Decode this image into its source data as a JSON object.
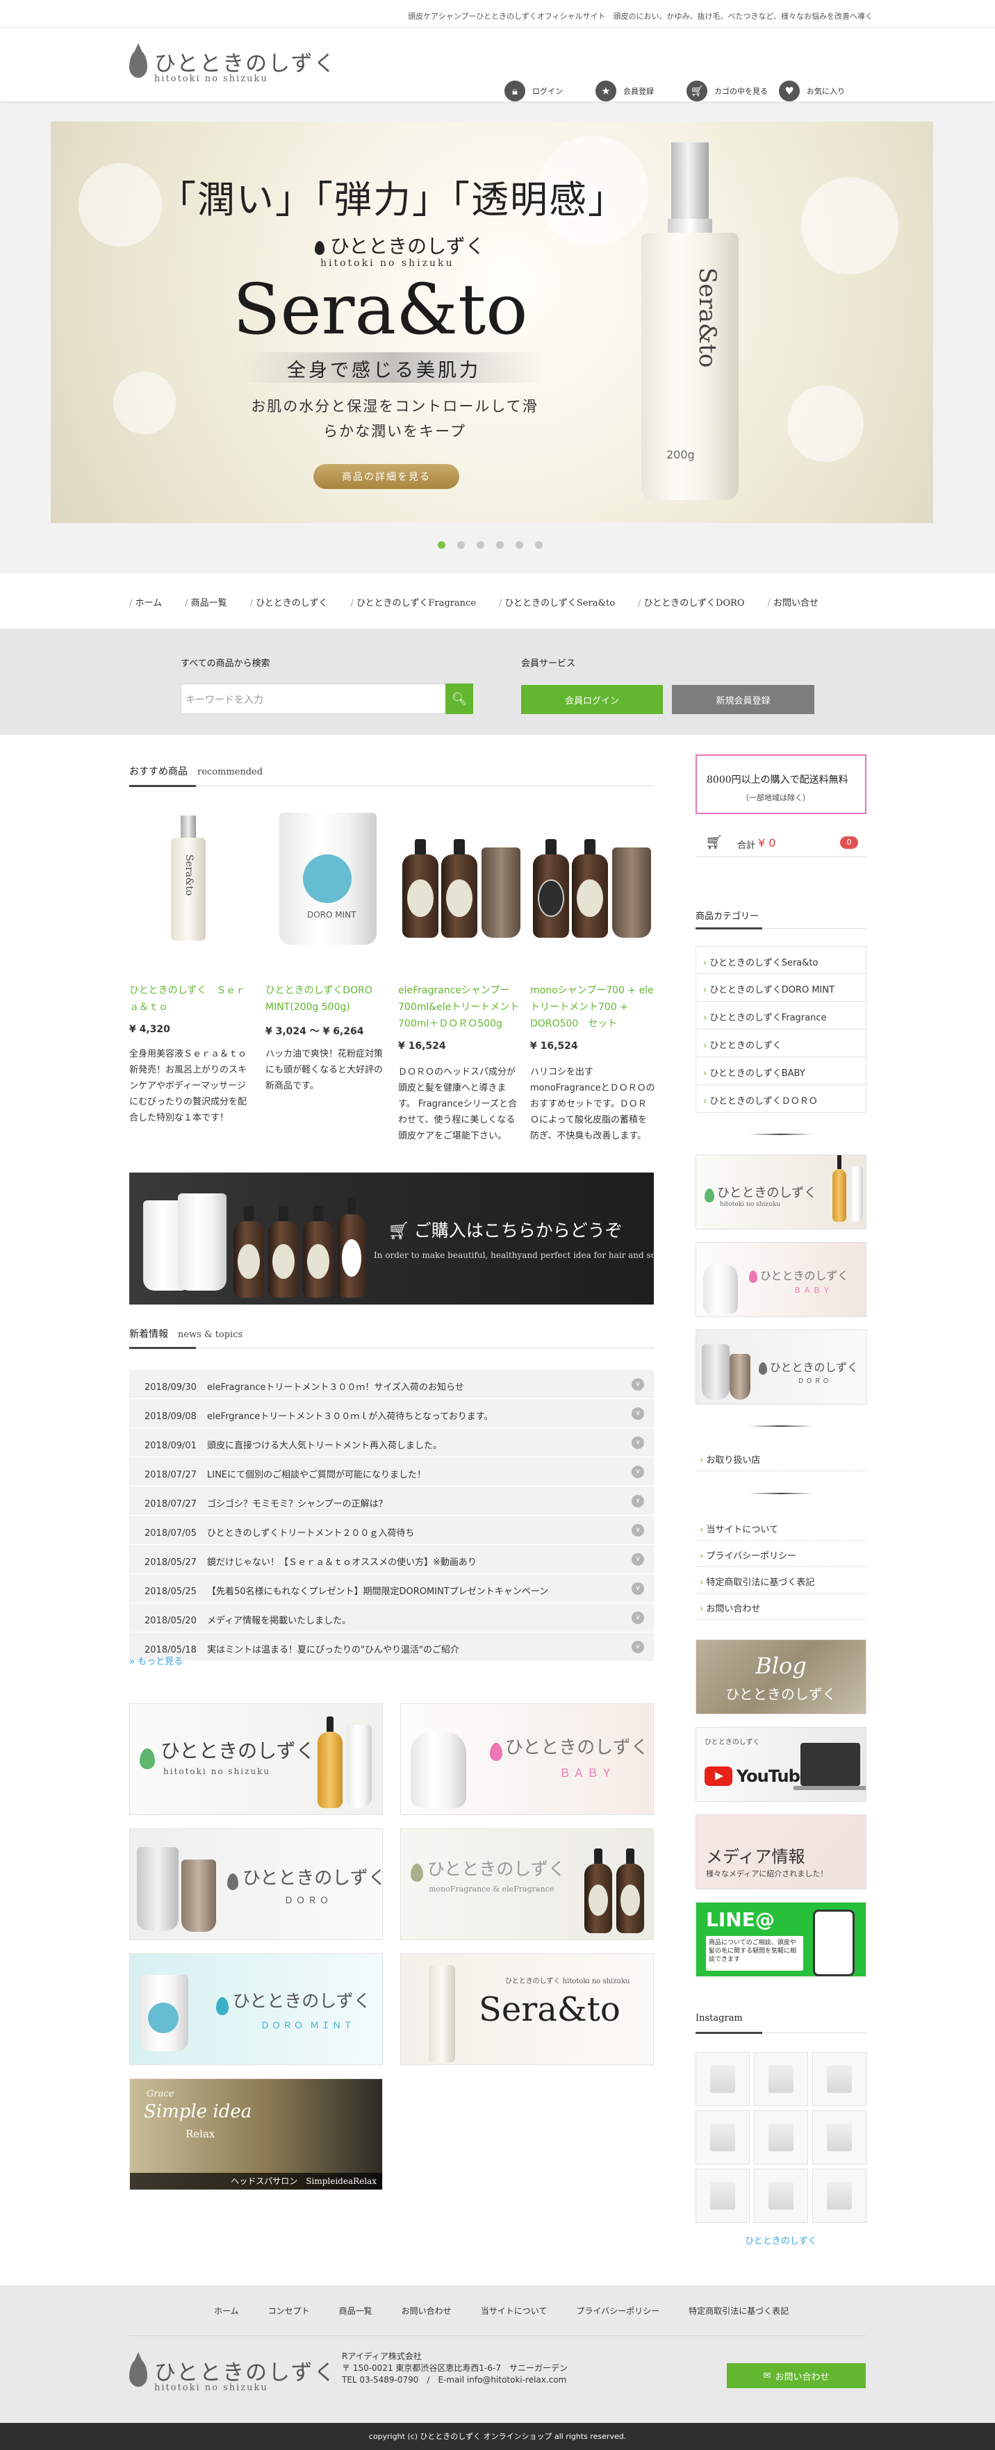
{
  "topbar": {
    "tagline": "頭皮ケアシャンプーひとときのしずくオフィシャルサイト　頭皮のにおい、かゆみ、抜け毛、べたつきなど、様々なお悩みを改善へ導く"
  },
  "logo": {
    "jp": "ひとときのしずく",
    "en": "hitotoki no shizuku"
  },
  "header_nav": [
    {
      "label": "ログイン",
      "icon": "lock-icon"
    },
    {
      "label": "会員登録",
      "icon": "star-icon"
    },
    {
      "label": "カゴの中を見る",
      "icon": "cart-icon"
    },
    {
      "label": "お気に入り",
      "icon": "heart-icon"
    }
  ],
  "hero": {
    "headline": "「潤い」「弾力」「透明感」",
    "brand_jp": "ひとときのしずく",
    "brand_en": "hitotoki no shizuku",
    "product": "Sera&to",
    "subhead": "全身で感じる美肌力",
    "copy": "お肌の水分と保湿をコントロールして滑らかな潤いをキープ",
    "button": "商品の詳細を見る",
    "bottle_text": "Sera&to",
    "bottle_size": "200g",
    "slides": 6,
    "active_slide": 1
  },
  "global_nav": [
    "ホーム",
    "商品一覧",
    "ひとときのしずく",
    "ひとときのしずくFragrance",
    "ひとときのしずくSera&to",
    "ひとときのしずくDORO",
    "お問い合せ"
  ],
  "search": {
    "title": "すべての商品から検索",
    "placeholder": "キーワードを入力",
    "member_title": "会員サービス",
    "login": "会員ログイン",
    "register": "新規会員登録"
  },
  "recommended": {
    "title": "おすすめ商品",
    "title_en": "recommended",
    "items": [
      {
        "name": "ひとときのしずく　Ｓｅｒａ＆ｔｏ",
        "price": "¥ 4,320",
        "desc": "全身用美容液Ｓｅｒａ＆ｔｏ新発売！お風呂上がりのスキンケアやボディーマッサージにむびったりの贅沢成分を配合した特別な１本です！"
      },
      {
        "name": "ひとときのしずくDORO MINT(200g 500g)",
        "price": "¥ 3,024 ～ ¥ 6,264",
        "desc": "ハッカ油で爽快！花粉症対策にも頭が軽くなると大好評の新商品です。"
      },
      {
        "name": "eleFragranceシャンプー700ml&eleトリートメント700ml＋ＤＯＲＯ500g",
        "price": "¥ 16,524",
        "desc": "ＤＯＲＯのヘッドスパ成分が頭皮と髪を健康へと導きます。 Fragranceシリーズと合わせて、使う程に美しくなる頭皮ケアをご堪能下さい。"
      },
      {
        "name": "monoシャンプー700 + eleトリートメント700 + DORO500　セット",
        "price": "¥ 16,524",
        "desc": "ハリコシを出すmonoFragranceとＤＯＲＯのおすすめセットです。ＤＯＲＯによって酸化皮脂の蓄積を防ぎ、不快臭も改善します。"
      }
    ]
  },
  "purchase_banner": {
    "title": "ご購入はこちらからどうぞ",
    "subtitle": "In order to make beautiful, healthyand perfect idea for hair and scalp."
  },
  "news": {
    "title": "新着情報",
    "title_en": "news & topics",
    "items": [
      {
        "date": "2018/09/30",
        "text": "eleFragranceトリートメント３００ｍ！サイズ入荷のお知らせ"
      },
      {
        "date": "2018/09/08",
        "text": "eleFrgranceトリートメント３００ｍｌが入荷待ちとなっております。"
      },
      {
        "date": "2018/09/01",
        "text": "頭皮に直接つける大人気トリートメント再入荷しました。"
      },
      {
        "date": "2018/07/27",
        "text": "LINEにて個別のご相談やご質問が可能になりました！"
      },
      {
        "date": "2018/07/27",
        "text": "ゴシゴシ？モミモミ？シャンプーの正解は？"
      },
      {
        "date": "2018/07/05",
        "text": "ひとときのしずくトリートメント２００ｇ入荷待ち"
      },
      {
        "date": "2018/05/27",
        "text": "鏡だけじゃない！【Ｓｅｒａ＆ｔｏオススメの使い方】※動画あり"
      },
      {
        "date": "2018/05/25",
        "text": "【先着50名様にもれなくプレゼント】期間限定DOROMINTプレゼントキャンペーン"
      },
      {
        "date": "2018/05/20",
        "text": "メディア情報を掲載いたしました。"
      },
      {
        "date": "2018/05/18",
        "text": "実はミントは温まる！夏にぴったりの\"ひんやり温活\"のご紹介"
      }
    ],
    "more": "» もっと見る"
  },
  "tiles": [
    {
      "title": "ひとときのしずく",
      "sub": "hitotoki no shizuku"
    },
    {
      "title": "ひとときのしずく",
      "sub": "ＢＡＢＹ"
    },
    {
      "title": "ひとときのしずく",
      "sub": "ＤＯＲＯ"
    },
    {
      "title": "ひとときのしずく",
      "sub": "monoFragrance & eleFragrance"
    },
    {
      "title": "ひとときのしずく",
      "sub": "ＤＯＲＯ ＭＩＮＴ"
    },
    {
      "title": "Sera&to",
      "sub": "ひとときのしずく hitotoki no shizuku"
    },
    {
      "title": "Simple idea",
      "sub": "Relax",
      "pre": "Grace",
      "caption": "ヘッドスパサロン　SimpleideaRelax"
    }
  ],
  "sidebar": {
    "free_shipping": "8000円以上の購入で配送料無料",
    "free_shipping_note": "（一部地域は除く）",
    "cart_label": "合計",
    "cart_total": "¥ 0",
    "cart_count": "0",
    "category_title": "商品カテゴリー",
    "categories": [
      "ひとときのしずくSera&to",
      "ひとときのしずくDORO MINT",
      "ひとときのしずくFragrance",
      "ひとときのしずく",
      "ひとときのしずくBABY",
      "ひとときのしずくＤＯＲＯ"
    ],
    "banners": [
      {
        "title": "ひとときのしずく",
        "sub": "hitotoki no shizuku"
      },
      {
        "title": "ひとときのしずく",
        "sub": "ＢＡＢＹ"
      },
      {
        "title": "ひとときのしずく",
        "sub": "ＤＯＲＯ"
      }
    ],
    "shops": [
      "お取り扱い店"
    ],
    "links": [
      "当サイトについて",
      "プライバシーポリシー",
      "特定商取引法に基づく表記",
      "お問い合わせ"
    ],
    "blog": {
      "title": "Blog",
      "sub": "ひとときのしずく"
    },
    "youtube": {
      "label": "YouTube",
      "sub": "ひとときのしずく"
    },
    "media": {
      "title": "メディア情報",
      "sub": "様々なメディアに紹介されました！"
    },
    "line": {
      "title": "LINE@",
      "text": "商品についてのご相談、頭皮や髪の毛に関する疑問を気軽に相談できます"
    },
    "instagram_title": "Instagram",
    "instagram_link": "ひとときのしずく"
  },
  "footer": {
    "nav": [
      "ホーム",
      "コンセプト",
      "商品一覧",
      "お問い合わせ",
      "当サイトについて",
      "プライバシーポリシー",
      "特定商取引法に基づく表記"
    ],
    "company": "Rアイディア株式会社",
    "address": "〒 150-0021 東京都渋谷区恵比寿西1-6-7　サニーガーデン",
    "contact": "TEL 03-5489-0790　/　E-mail  info@hitotoki-relax.com",
    "button": "お問い合わせ",
    "copyright": "copyright (c) ひとときのしずく オンラインショップ all rights reserved."
  },
  "colors": {
    "accent": "#63b62f",
    "link": "#3aa3e3",
    "pink": "#ec76b6",
    "gold": "#b8944f"
  }
}
